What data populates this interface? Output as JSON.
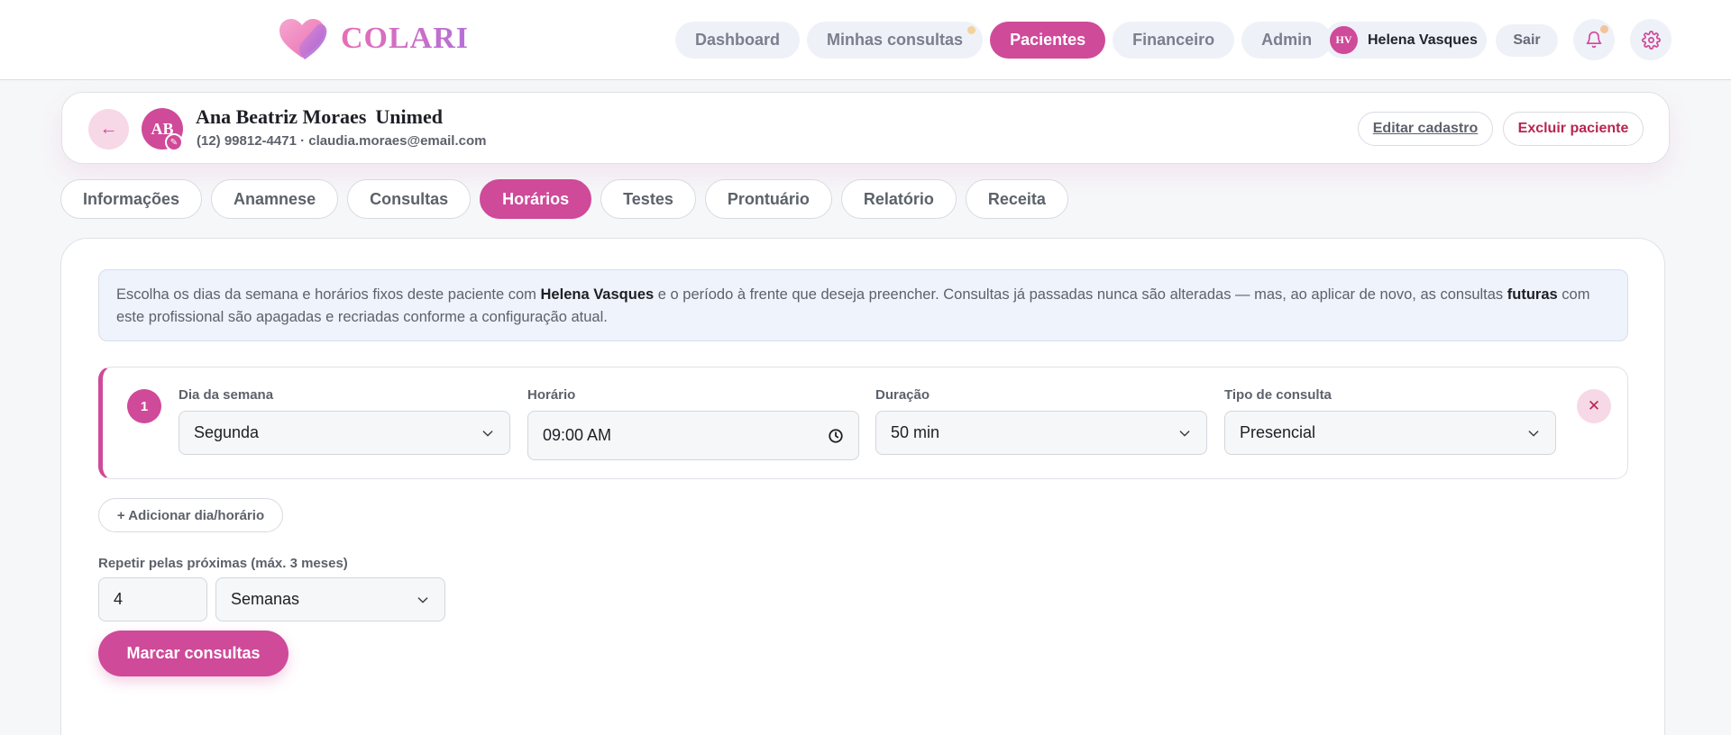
{
  "brand": {
    "name": "COLARI"
  },
  "nav": {
    "items": [
      {
        "label": "Dashboard"
      },
      {
        "label": "Minhas consultas"
      },
      {
        "label": "Pacientes"
      },
      {
        "label": "Financeiro"
      },
      {
        "label": "Admin"
      }
    ],
    "active": "Pacientes"
  },
  "user": {
    "initials": "HV",
    "name": "Helena Vasques",
    "logout_label": "Sair"
  },
  "icons": {
    "notifications": "bell-icon",
    "settings": "gear-icon",
    "back": "arrow-left-icon",
    "edit_avatar": "pencil-icon",
    "remove": "close-icon",
    "dropdown": "chevron-down-icon",
    "time": "clock-icon"
  },
  "patient": {
    "back_label": "←",
    "initials": "AB",
    "name": "Ana Beatriz Moraes",
    "plan": "Unimed",
    "contact": "(12) 99812-4471 · claudia.moraes@email.com",
    "edit_label": "Editar cadastro",
    "delete_label": "Excluir paciente"
  },
  "tabs": [
    {
      "label": "Informações"
    },
    {
      "label": "Anamnese"
    },
    {
      "label": "Consultas"
    },
    {
      "label": "Horários"
    },
    {
      "label": "Testes"
    },
    {
      "label": "Prontuário"
    },
    {
      "label": "Relatório"
    },
    {
      "label": "Receita"
    }
  ],
  "active_tab": "Horários",
  "info": {
    "part1": "Escolha os dias da semana e horários fixos deste paciente com ",
    "professional": "Helena Vasques",
    "part2": " e o período à frente que deseja preencher. Consultas já passadas nunca são alteradas — mas, ao aplicar de novo, as consultas ",
    "futuras": "futuras",
    "part3": " com este profissional são apagadas e recriadas conforme a configuração atual."
  },
  "slot": {
    "number": "1",
    "day_label": "Dia da semana",
    "day_value": "Segunda",
    "time_label": "Horário",
    "time_value": "09:00 AM",
    "duration_label": "Duração",
    "duration_value": "50 min",
    "type_label": "Tipo de consulta",
    "type_value": "Presencial",
    "remove_label": "✕"
  },
  "add_label": "+ Adicionar dia/horário",
  "repeat": {
    "label": "Repetir pelas próximas (máx. 3 meses)",
    "count": "4",
    "unit": "Semanas"
  },
  "submit_label": "Marcar consultas",
  "colors": {
    "accent": "#cf4a99",
    "pill_bg": "#eef1f8",
    "info_bg": "#eef3fc",
    "danger": "#b8264f"
  }
}
